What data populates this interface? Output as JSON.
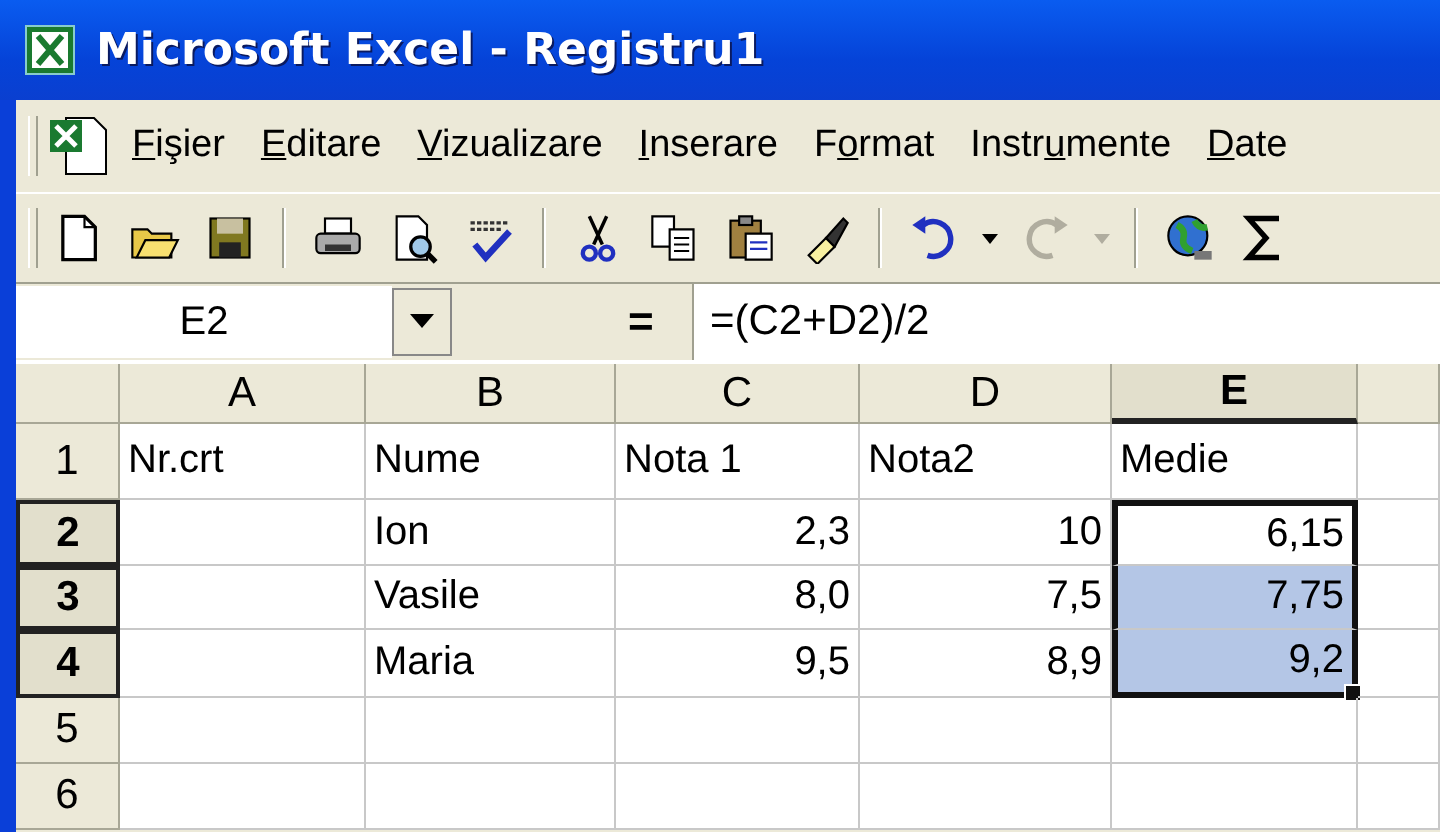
{
  "window": {
    "title": "Microsoft Excel - Registru1"
  },
  "menu": [
    {
      "key": "F",
      "post": "işier"
    },
    {
      "key": "E",
      "post": "ditare"
    },
    {
      "key": "V",
      "post": "izualizare"
    },
    {
      "key": "I",
      "post": "nserare"
    },
    {
      "pre": "F",
      "key": "o",
      "post": "rmat"
    },
    {
      "pre": "Instr",
      "key": "u",
      "post": "mente"
    },
    {
      "key": "D",
      "post": "ate"
    }
  ],
  "formula_bar": {
    "name_box": "E2",
    "equals": "=",
    "formula": "=(C2+D2)/2"
  },
  "sheet": {
    "columns": [
      {
        "label": "A",
        "selected": false
      },
      {
        "label": "B",
        "selected": false
      },
      {
        "label": "C",
        "selected": false
      },
      {
        "label": "D",
        "selected": false
      },
      {
        "label": "E",
        "selected": true
      }
    ],
    "rows": [
      {
        "label": "1",
        "selected": false,
        "cells": [
          {
            "text": "Nr.crt",
            "kind": "text",
            "selected": false
          },
          {
            "text": "Nume",
            "kind": "text",
            "selected": false
          },
          {
            "text": "Nota 1",
            "kind": "text",
            "selected": false
          },
          {
            "text": "Nota2",
            "kind": "text",
            "selected": false
          },
          {
            "text": "Medie",
            "kind": "text",
            "selected": false
          }
        ]
      },
      {
        "label": "2",
        "selected": true,
        "cells": [
          {
            "selected": false
          },
          {
            "text": "Ion",
            "kind": "text",
            "selected": false
          },
          {
            "text": "2,3",
            "kind": "number",
            "selected": false
          },
          {
            "text": "10",
            "kind": "number",
            "selected": false
          },
          {
            "text": "6,15",
            "kind": "number",
            "selected": true,
            "active": true
          }
        ]
      },
      {
        "label": "3",
        "selected": true,
        "cells": [
          {
            "selected": false
          },
          {
            "text": "Vasile",
            "kind": "text",
            "selected": false
          },
          {
            "text": "8,0",
            "kind": "number",
            "selected": false
          },
          {
            "text": "7,5",
            "kind": "number",
            "selected": false
          },
          {
            "text": "7,75",
            "kind": "number",
            "selected": true
          }
        ]
      },
      {
        "label": "4",
        "selected": true,
        "cells": [
          {
            "selected": false
          },
          {
            "text": "Maria",
            "kind": "text",
            "selected": false
          },
          {
            "text": "9,5",
            "kind": "number",
            "selected": false
          },
          {
            "text": "8,9",
            "kind": "number",
            "selected": false
          },
          {
            "text": "9,2",
            "kind": "number",
            "selected": true
          }
        ]
      },
      {
        "label": "5",
        "selected": false,
        "cells": [
          {
            "selected": false
          },
          {
            "selected": false
          },
          {
            "selected": false
          },
          {
            "selected": false
          },
          {
            "selected": false
          }
        ]
      },
      {
        "label": "6",
        "selected": false,
        "cells": [
          {
            "selected": false
          },
          {
            "selected": false
          },
          {
            "selected": false
          },
          {
            "selected": false
          },
          {
            "selected": false
          }
        ]
      }
    ]
  }
}
